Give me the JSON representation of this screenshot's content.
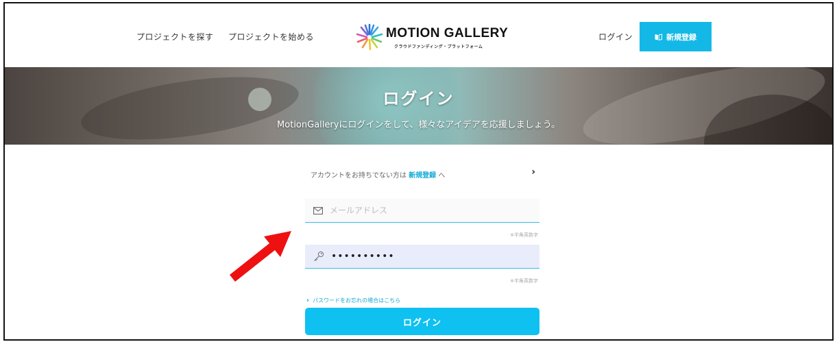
{
  "header": {
    "nav": {
      "browse": "プロジェクトを探す",
      "start": "プロジェクトを始める",
      "login": "ログイン"
    },
    "logo": {
      "name": "MOTION GALLERY",
      "tagline": "クラウドファンディング・プラットフォーム"
    },
    "signup_label": "新規登録",
    "signup_icon": "book-icon"
  },
  "hero": {
    "title": "ログイン",
    "subtitle": "MotionGalleryにログインをして、様々なアイデアを応援しましょう。"
  },
  "form": {
    "account_prompt": "アカウントをお持ちでない方は",
    "account_link": "新規登録",
    "account_suffix": "へ",
    "email": {
      "placeholder": "メールアドレス",
      "value": "",
      "hint": "※半角英数字",
      "icon": "mail-icon"
    },
    "password": {
      "value": "••••••••••",
      "hint": "※半角英数字",
      "icon": "key-icon"
    },
    "forgot_label": "パスワードをお忘れの場合はこちら",
    "submit_label": "ログイン"
  },
  "colors": {
    "accent": "#14b8e6",
    "annotation_arrow": "#ee1111"
  }
}
